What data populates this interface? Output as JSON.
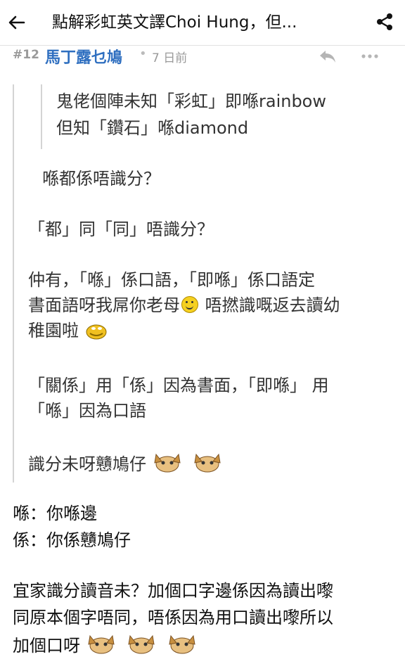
{
  "header": {
    "back_icon": "arrow-left-icon",
    "title": "點解彩虹英文譯Choi Hung，但...",
    "share_icon": "share-icon"
  },
  "post": {
    "number": "#12",
    "username": "馬丁露乜鳩",
    "separator": "•",
    "time": "7 日前",
    "reply_icon": "reply-icon",
    "more_icon": "more-icon",
    "username_color": "#2f6fc0"
  },
  "quote": {
    "inner_line1": "鬼佬個陣未知「彩虹」即喺rainbow",
    "inner_line2": "但知「鑽石」喺diamond",
    "line1": "喺都係唔識分？",
    "line2": "「都」同「同」唔識分？",
    "line3": "仲有，「喺」係口語，「即喺」係口語定",
    "line4a": "書面語呀我屌你老母",
    "line4b": " 唔撚識嘅返去讀幼",
    "line5": "稚園啦",
    "line6": "「關係」用「係」因為書面，「即喺」 用",
    "line7": "「喺」因為口語",
    "line8": "識分未呀戇鳩仔"
  },
  "reply": {
    "line1": "喺：你喺邊",
    "line2": "係：你係戇鳩仔",
    "line3": "宜家識分讀音未？加個口字邊係因為讀出嚟",
    "line4": "同原本個字唔同，唔係因為用口讀出嚟所以",
    "line5": "加個口呀"
  }
}
